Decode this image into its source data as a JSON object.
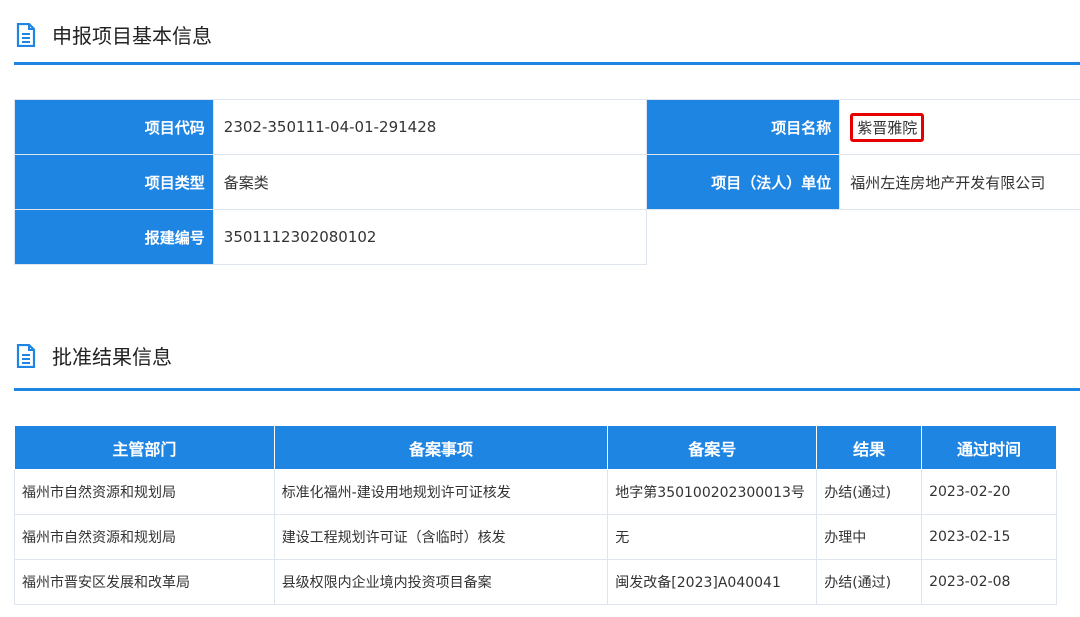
{
  "section1": {
    "title": "申报项目基本信息",
    "rows": [
      {
        "label_left": "项目代码",
        "value_left": "2302-350111-04-01-291428",
        "label_right": "项目名称",
        "value_right": "紫晋雅院"
      },
      {
        "label_left": "项目类型",
        "value_left": "备案类",
        "label_right": "项目（法人）单位",
        "value_right": "福州左连房地产开发有限公司"
      },
      {
        "label_left": "报建编号",
        "value_left": "3501112302080102"
      }
    ]
  },
  "section2": {
    "title": "批准结果信息",
    "headers": [
      "主管部门",
      "备案事项",
      "备案号",
      "结果",
      "通过时间"
    ],
    "rows": [
      [
        "福州市自然资源和规划局",
        "标准化福州-建设用地规划许可证核发",
        "地字第350100202300013号",
        "办结(通过)",
        "2023-02-20"
      ],
      [
        "福州市自然资源和规划局",
        "建设工程规划许可证（含临时）核发",
        "无",
        "办理中",
        "2023-02-15"
      ],
      [
        "福州市晋安区发展和改革局",
        "县级权限内企业境内投资项目备案",
        "闽发改备[2023]A040041",
        "办结(通过)",
        "2023-02-08"
      ]
    ]
  },
  "colors": {
    "accent": "#1f85e3",
    "highlight_border": "#e60000"
  }
}
